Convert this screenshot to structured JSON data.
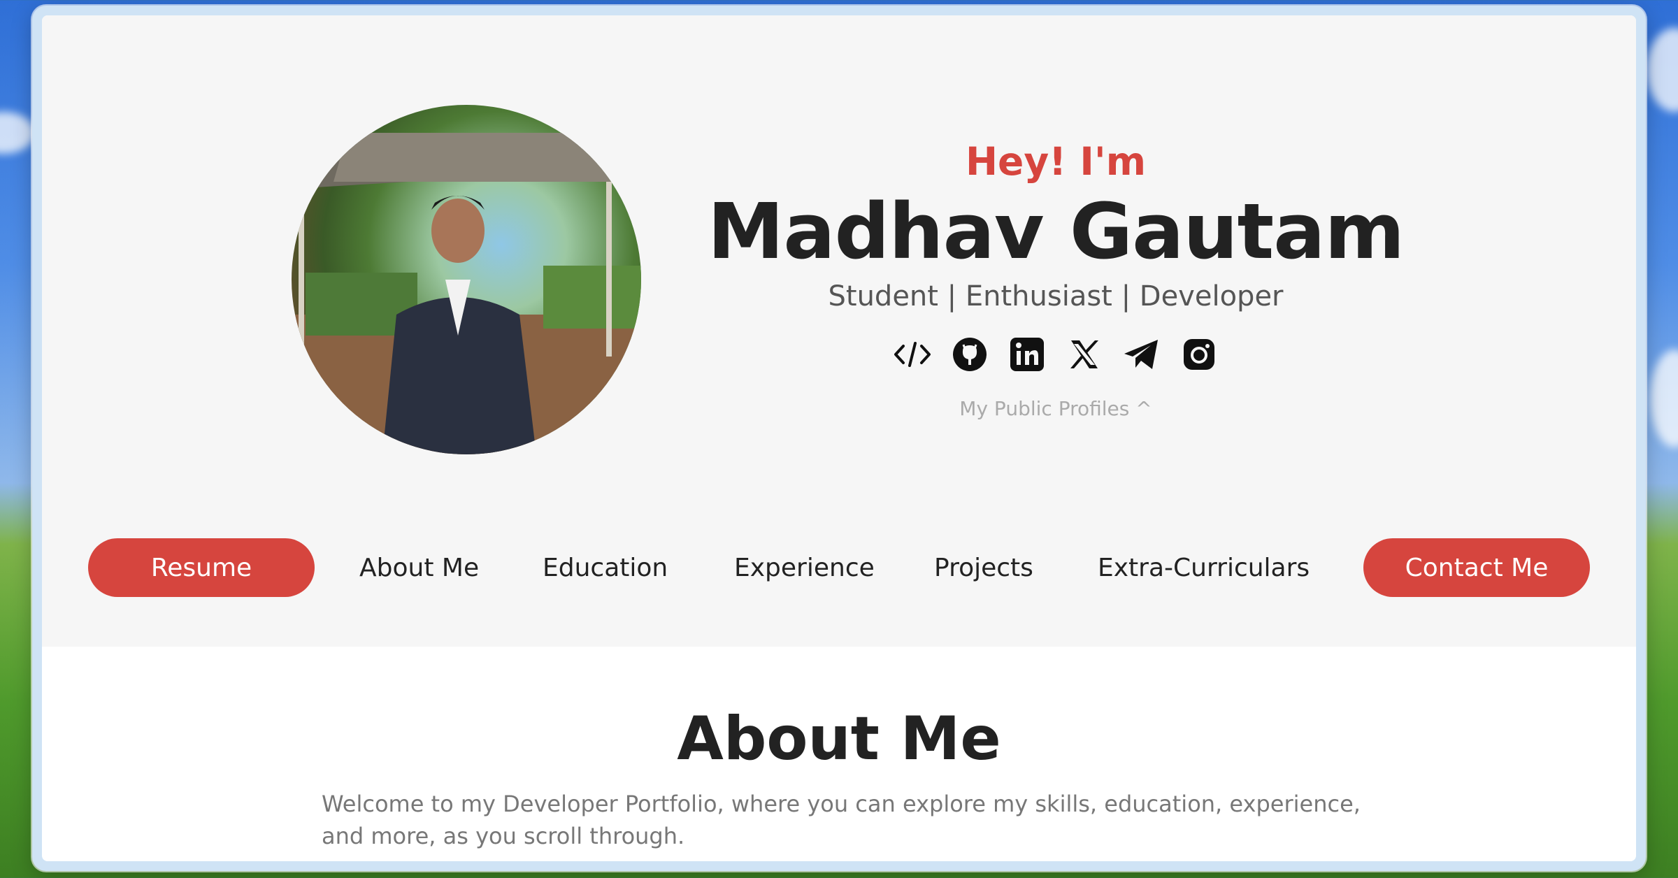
{
  "profile": {
    "greeting": "Hey! I'm",
    "name": "Madhav Gautam",
    "tagline": "Student | Enthusiast | Developer",
    "photo_alt": "Profile photo"
  },
  "socials": [
    {
      "icon": "code-icon"
    },
    {
      "icon": "github-icon"
    },
    {
      "icon": "linkedin-icon"
    },
    {
      "icon": "x-icon"
    },
    {
      "icon": "telegram-icon"
    },
    {
      "icon": "instagram-icon"
    }
  ],
  "profiles_toggle": "My Public Profiles ^",
  "nav": {
    "resume": "Resume",
    "about": "About Me",
    "education": "Education",
    "experience": "Experience",
    "projects": "Projects",
    "extra": "Extra-Curriculars",
    "contact": "Contact Me"
  },
  "about": {
    "title": "About Me",
    "text": "Welcome to my Developer Portfolio, where you can explore my skills, education, experience, and more, as you scroll through."
  },
  "colors": {
    "accent": "#d6453e",
    "hero_bg": "#f6f6f6",
    "text_dark": "#222222",
    "text_muted": "#777777"
  }
}
